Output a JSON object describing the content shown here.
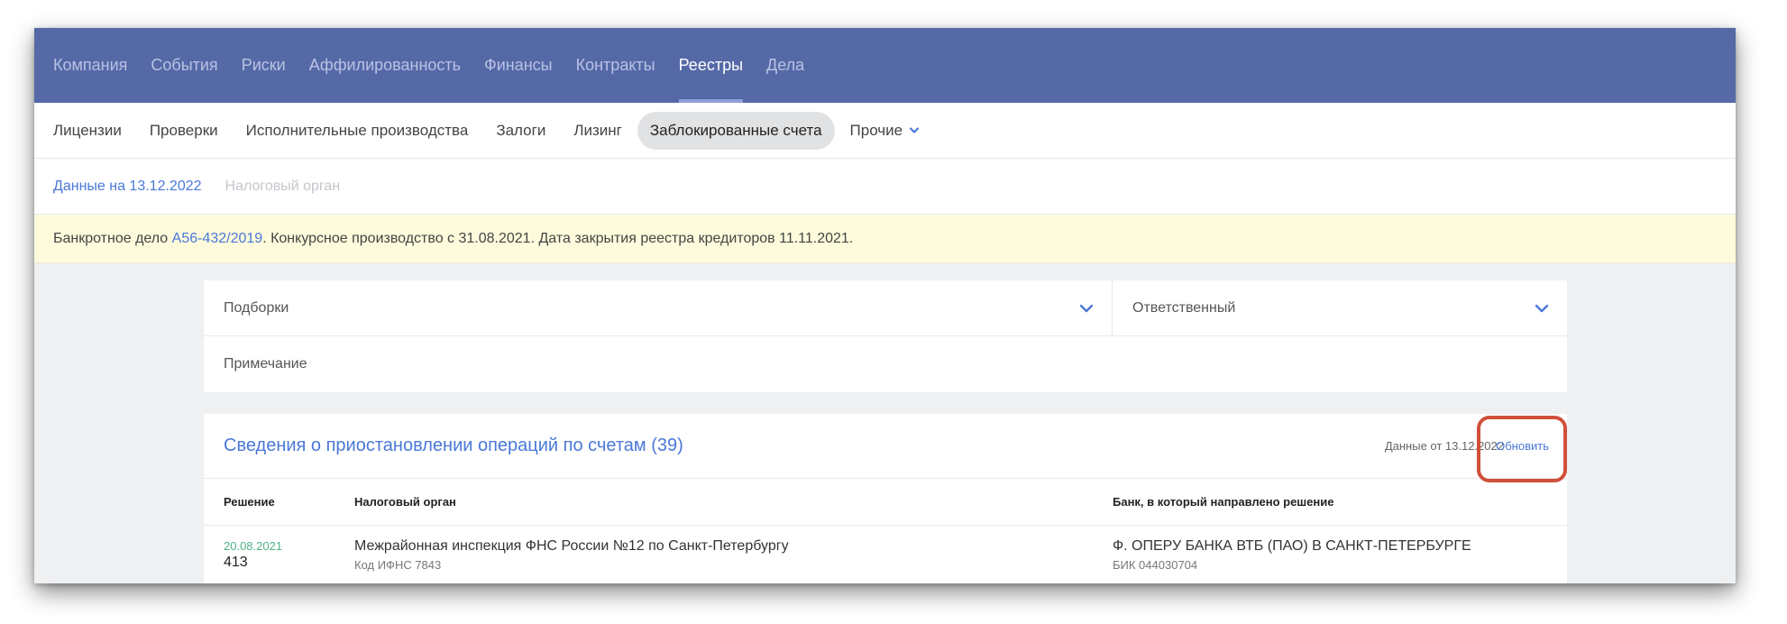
{
  "topnav": {
    "items": [
      "Компания",
      "События",
      "Риски",
      "Аффилированность",
      "Финансы",
      "Контракты",
      "Реестры",
      "Дела"
    ],
    "active": "Реестры"
  },
  "subnav": {
    "items": [
      "Лицензии",
      "Проверки",
      "Исполнительные производства",
      "Залоги",
      "Лизинг",
      "Заблокированные счета"
    ],
    "active": "Заблокированные счета",
    "more_label": "Прочие"
  },
  "datarow": {
    "date_label": "Данные на 13.12.2022",
    "tax_label": "Налоговый орган"
  },
  "banner": {
    "prefix": "Банкротное дело ",
    "case_link": "А56-432/2019",
    "suffix": ". Конкурсное производство с 31.08.2021. Дата закрытия реестра кредиторов 11.11.2021."
  },
  "filters": {
    "selections_label": "Подборки",
    "responsible_label": "Ответственный",
    "note_label": "Примечание"
  },
  "accounts": {
    "title": "Сведения о приостановлении операций по счетам (39)",
    "date_label": "Данные от 13.12.2022",
    "refresh_label": "Обновить",
    "columns": [
      "Решение",
      "Налоговый орган",
      "Банк, в который направлено решение"
    ],
    "rows": [
      {
        "date": "20.08.2021",
        "number": "413",
        "authority": "Межрайонная инспекция ФНС России №12 по Санкт-Петербургу",
        "authority_code": "Код ИФНС 7843",
        "bank": "Ф. ОПЕРУ БАНКА ВТБ (ПАО) В САНКТ-ПЕТЕРБУРГЕ",
        "bik": "БИК 044030704"
      }
    ]
  },
  "colors": {
    "nav_bg": "#5569a7",
    "accent": "#4a78d8",
    "banner_bg": "#fdfbdc",
    "highlight": "#d0503a",
    "date_green": "#4fb287"
  }
}
